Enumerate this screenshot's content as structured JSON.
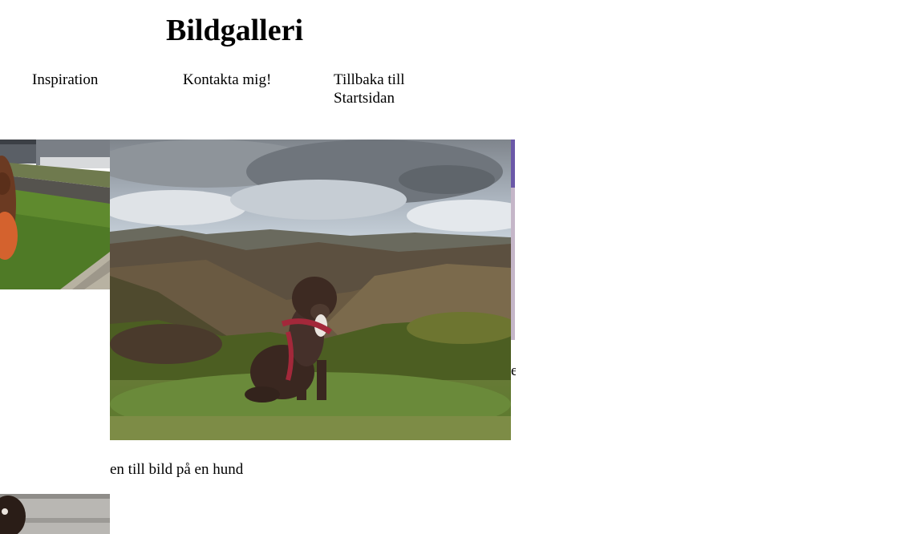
{
  "header": {
    "title": "Bildgalleri"
  },
  "nav": {
    "items": [
      {
        "label": "Inspiration"
      },
      {
        "label": "Kontakta mig!"
      },
      {
        "label": "Tillbaka till Startsidan"
      }
    ]
  },
  "gallery": {
    "caption": "en till bild på en hund",
    "right_caption_fragment": "e"
  }
}
